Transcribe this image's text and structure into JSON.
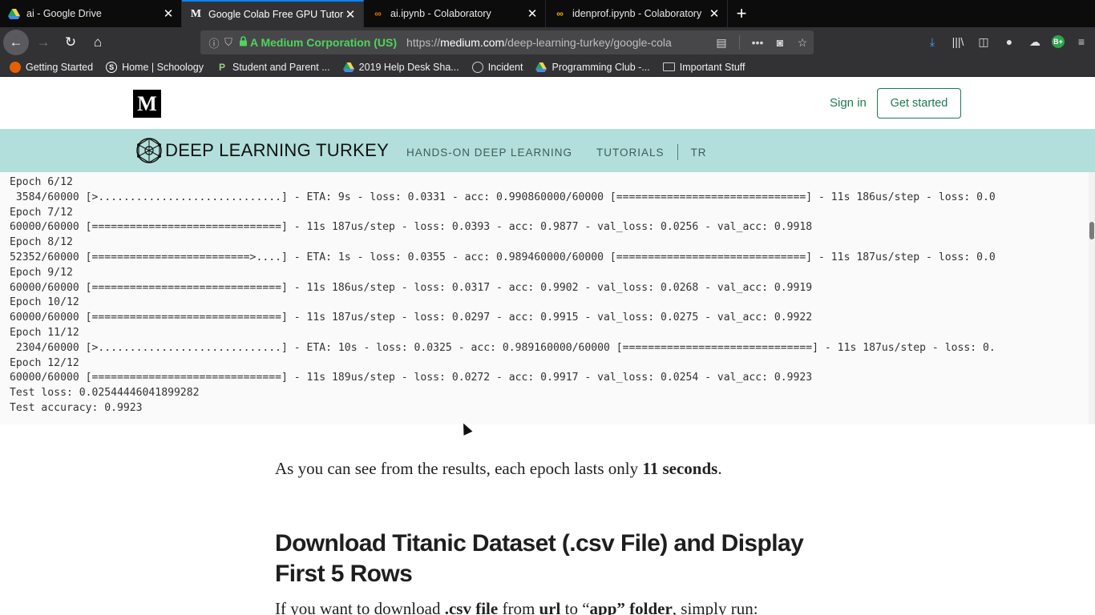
{
  "tabs": [
    {
      "title": "ai - Google Drive",
      "icon": "google-drive-icon",
      "active": false
    },
    {
      "title": "Google Colab Free GPU Tutorial",
      "icon": "medium-icon",
      "active": true
    },
    {
      "title": "ai.ipynb - Colaboratory",
      "icon": "colab-icon",
      "active": false
    },
    {
      "title": "idenprof.ipynb - Colaboratory",
      "icon": "colab-icon",
      "active": false
    }
  ],
  "nav": {
    "org": "A Medium Corporation (US)",
    "url_prefix": "https://",
    "url_host": "medium.com",
    "url_path": "/deep-learning-turkey/google-cola"
  },
  "bookmarks": [
    {
      "label": "Getting Started",
      "icon": "firefox-icon",
      "color": "#e66000"
    },
    {
      "label": "Home | Schoology",
      "icon": "schoology-icon",
      "color": "#2a6ebb"
    },
    {
      "label": "Student and Parent ...",
      "icon": "bookmark-p-icon",
      "color": "#3a7d44"
    },
    {
      "label": "2019 Help Desk Sha...",
      "icon": "google-drive-icon",
      "color": "#f4b400"
    },
    {
      "label": "Incident",
      "icon": "globe-icon",
      "color": "#777777"
    },
    {
      "label": "Programming Club -...",
      "icon": "google-drive-icon",
      "color": "#f4b400"
    },
    {
      "label": "Important Stuff",
      "icon": "folder-icon",
      "color": "#cccccc"
    }
  ],
  "header": {
    "logo": "M",
    "signin": "Sign in",
    "get_started": "Get started"
  },
  "publication": {
    "name_bold": "DEEP LEARNING",
    "name_rest": " TURKEY",
    "nav": [
      "HANDS-ON DEEP LEARNING",
      "TUTORIALS",
      "TR"
    ]
  },
  "code_lines": [
    "Epoch 6/12",
    " 3584/60000 [>.............................] - ETA: 9s - loss: 0.0331 - acc: 0.990860000/60000 [==============================] - 11s 186us/step - loss: 0.0",
    "Epoch 7/12",
    "60000/60000 [==============================] - 11s 187us/step - loss: 0.0393 - acc: 0.9877 - val_loss: 0.0256 - val_acc: 0.9918",
    "Epoch 8/12",
    "52352/60000 [=========================>....] - ETA: 1s - loss: 0.0355 - acc: 0.989460000/60000 [==============================] - 11s 187us/step - loss: 0.0",
    "Epoch 9/12",
    "60000/60000 [==============================] - 11s 186us/step - loss: 0.0317 - acc: 0.9902 - val_loss: 0.0268 - val_acc: 0.9919",
    "Epoch 10/12",
    "60000/60000 [==============================] - 11s 187us/step - loss: 0.0297 - acc: 0.9915 - val_loss: 0.0275 - val_acc: 0.9922",
    "Epoch 11/12",
    " 2304/60000 [>.............................] - ETA: 10s - loss: 0.0325 - acc: 0.989160000/60000 [==============================] - 11s 187us/step - loss: 0.",
    "Epoch 12/12",
    "60000/60000 [==============================] - 11s 189us/step - loss: 0.0272 - acc: 0.9917 - val_loss: 0.0254 - val_acc: 0.9923",
    "Test loss: 0.02544446041899282",
    "Test accuracy: 0.9923"
  ],
  "article": {
    "para1_pre": "As you can see from the results, each epoch lasts only ",
    "para1_bold": "11 seconds",
    "para1_post": ".",
    "heading": "Download Titanic Dataset (.csv File) and Display First 5 Rows",
    "para2_a": "If you want to download ",
    "para2_b": ".csv file",
    "para2_c": " from ",
    "para2_d": "url",
    "para2_e": " to “",
    "para2_f": "app",
    "para2_g": "” folder",
    "para2_h": ", simply run:"
  }
}
